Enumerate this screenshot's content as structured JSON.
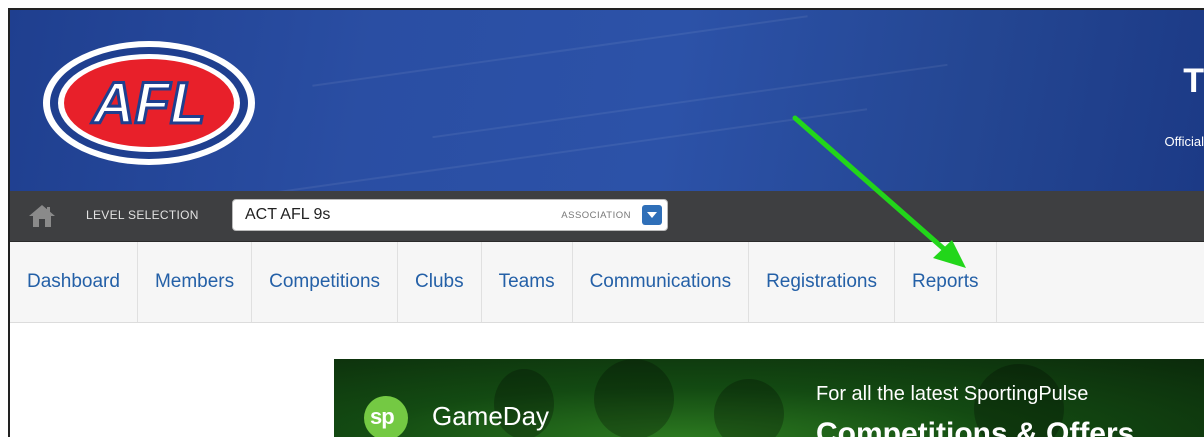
{
  "header": {
    "logo_text": "AFL",
    "title_partial": "T",
    "subtitle_partial": "Official"
  },
  "level_bar": {
    "home_icon": "home-icon",
    "label": "LEVEL SELECTION",
    "selected_value": "ACT AFL 9s",
    "level_type": "ASSOCIATION",
    "dropdown_icon": "chevron-down-icon"
  },
  "nav": {
    "items": [
      {
        "label": "Dashboard"
      },
      {
        "label": "Members"
      },
      {
        "label": "Competitions"
      },
      {
        "label": "Clubs"
      },
      {
        "label": "Teams"
      },
      {
        "label": "Communications"
      },
      {
        "label": "Registrations"
      },
      {
        "label": "Reports"
      }
    ]
  },
  "banner": {
    "sp_badge": "sp",
    "brand": "GameDay",
    "promo_line": "For all the latest SportingPulse",
    "promo_headline": "Competitions & Offers"
  },
  "annotation": {
    "arrow_color": "#22d61a",
    "target": "Reports"
  },
  "colors": {
    "header_blue": "#2a4ea3",
    "nav_link": "#2460a7",
    "afl_red": "#e8202a"
  }
}
